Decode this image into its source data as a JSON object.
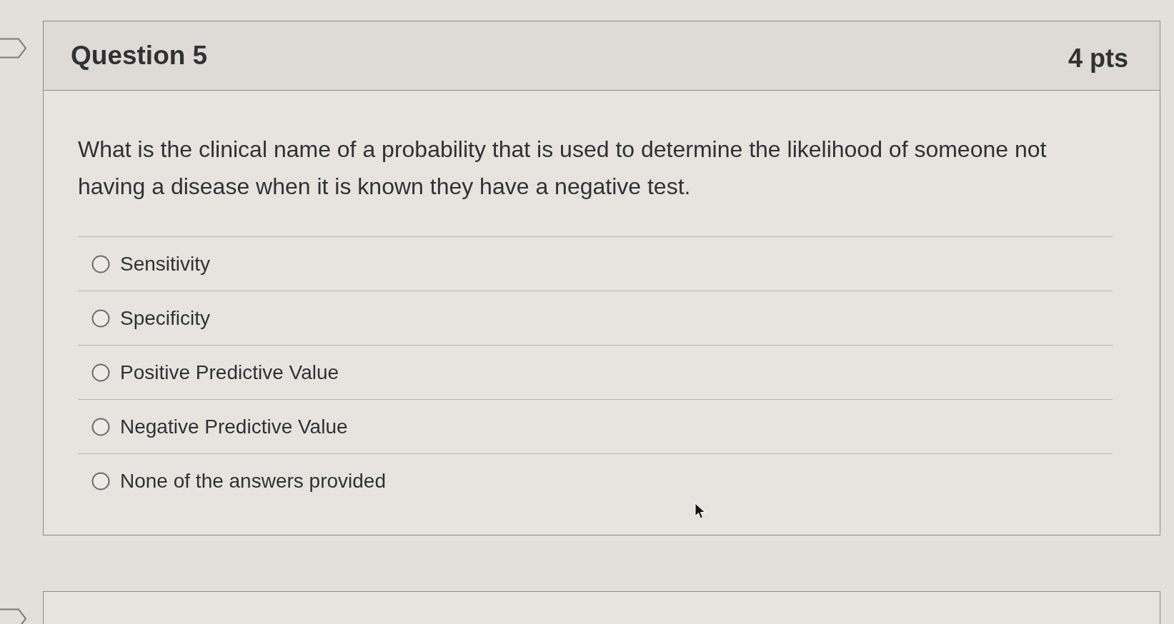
{
  "questions": [
    {
      "flagged": false,
      "title": "Question 5",
      "points": "4 pts",
      "prompt": "What is the clinical name of a probability that is used to determine the likelihood of someone not having a disease when it is known they have a negative test.",
      "answers": [
        {
          "label": "Sensitivity",
          "selected": false
        },
        {
          "label": "Specificity",
          "selected": false
        },
        {
          "label": "Positive Predictive Value",
          "selected": false
        },
        {
          "label": "Negative Predictive Value",
          "selected": false
        },
        {
          "label": "None of the answers provided",
          "selected": false
        }
      ]
    },
    {
      "flagged": false
    }
  ]
}
